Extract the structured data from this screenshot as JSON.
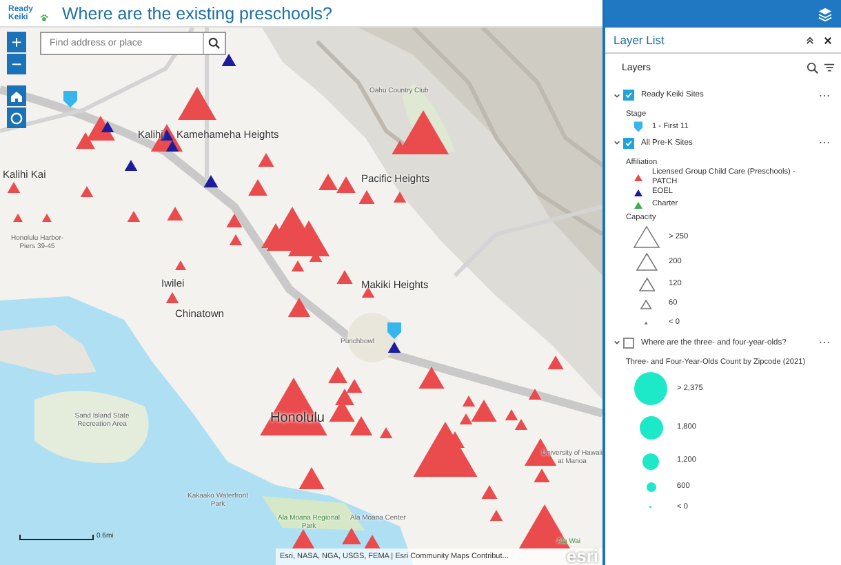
{
  "header": {
    "logo": "Ready Keiki",
    "title": "Where are the existing preschools?"
  },
  "map": {
    "search": {
      "placeholder": "Find address or place"
    },
    "zoom_in": "+",
    "zoom_out": "−",
    "labels": [
      {
        "text": "Oahu Country Club",
        "kind": "minor"
      },
      {
        "text": "Kalihi",
        "kind": "major"
      },
      {
        "text": "Kamehameha Heights",
        "kind": "major"
      },
      {
        "text": "Kalihi Kai",
        "kind": "major"
      },
      {
        "text": "Pacific Heights",
        "kind": "major"
      },
      {
        "text": "Honolulu Harbor-Piers 39-45",
        "kind": "minor"
      },
      {
        "text": "Iwilei",
        "kind": "major"
      },
      {
        "text": "Makiki Heights",
        "kind": "major"
      },
      {
        "text": "Chinatown",
        "kind": "major"
      },
      {
        "text": "Punchbowl",
        "kind": "minor"
      },
      {
        "text": "Honolulu",
        "kind": "city"
      },
      {
        "text": "Sand Island State Recreation Area",
        "kind": "minor"
      },
      {
        "text": "University of Hawaii at Manoa",
        "kind": "minor"
      },
      {
        "text": "Kakaako Waterfront Park",
        "kind": "minor"
      },
      {
        "text": "Ala Moana Regional Park",
        "kind": "park"
      },
      {
        "text": "Ala Moana Center",
        "kind": "minor"
      },
      {
        "text": "Ala Wai",
        "kind": "park"
      }
    ],
    "scale": "0.6mi",
    "attribution": "Esri, NASA, NGA, USGS, FEMA | Esri Community Maps Contribut...",
    "esri": "esri"
  },
  "panel": {
    "title": "Layer List",
    "heading": "Layers",
    "layers": [
      {
        "name": "Ready Keiki Sites",
        "checked": true,
        "groups": [
          {
            "title": "Stage",
            "items": [
              {
                "kind": "pin",
                "label": "1 - First 11"
              }
            ]
          }
        ]
      },
      {
        "name": "All Pre-K Sites",
        "checked": true,
        "groups": [
          {
            "title": "Affiliation",
            "items": [
              {
                "kind": "triangle",
                "color": "#e8484a",
                "label": "Licensed Group Child Care (Preschools) - PATCH"
              },
              {
                "kind": "triangle",
                "color": "#1c1c9a",
                "label": "EOEL"
              },
              {
                "kind": "triangle",
                "color": "#3cae4a",
                "label": "Charter"
              }
            ]
          },
          {
            "title": "Capacity",
            "items": [
              {
                "kind": "outline-triangle",
                "label": "> 250"
              },
              {
                "kind": "outline-triangle",
                "label": "200"
              },
              {
                "kind": "outline-triangle",
                "label": "120"
              },
              {
                "kind": "outline-triangle",
                "label": "60"
              },
              {
                "kind": "outline-triangle",
                "label": "< 0"
              }
            ]
          }
        ]
      },
      {
        "name": "Where are the three- and four-year-olds?",
        "checked": false,
        "groups": [
          {
            "title": "Three- and Four-Year-Olds Count by Zipcode (2021)",
            "items": [
              {
                "kind": "circle",
                "label": "> 2,375"
              },
              {
                "kind": "circle",
                "label": "1,800"
              },
              {
                "kind": "circle",
                "label": "1,200"
              },
              {
                "kind": "circle",
                "label": "600"
              },
              {
                "kind": "circle",
                "label": "< 0"
              }
            ]
          }
        ]
      }
    ]
  }
}
